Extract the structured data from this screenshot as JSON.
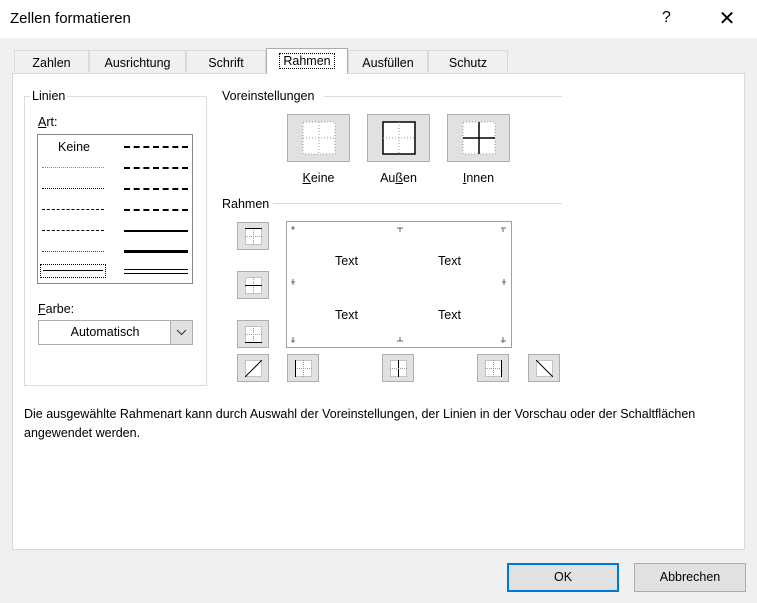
{
  "window": {
    "title": "Zellen formatieren",
    "help": "?",
    "close": "✕"
  },
  "tabs": [
    {
      "label": "Zahlen"
    },
    {
      "label": "Ausrichtung"
    },
    {
      "label": "Schrift"
    },
    {
      "label": "Rahmen"
    },
    {
      "label": "Ausfüllen"
    },
    {
      "label": "Schutz"
    }
  ],
  "lines_group": {
    "title": "Linien",
    "style_label_pre": "",
    "style_label_u": "A",
    "style_label_post": "rt:",
    "none_label": "Keine",
    "color_label_u": "F",
    "color_label_post": "arbe:",
    "color_value": "Automatisch"
  },
  "presets": {
    "title": "Voreinstellungen",
    "items": [
      {
        "pre": "",
        "u": "K",
        "post": "eine"
      },
      {
        "pre": "Au",
        "u": "ß",
        "post": "en"
      },
      {
        "pre": "",
        "u": "I",
        "post": "nnen"
      }
    ]
  },
  "border": {
    "title": "Rahmen",
    "preview_texts": [
      "Text",
      "Text",
      "Text",
      "Text"
    ]
  },
  "description": "Die ausgewählte Rahmenart kann durch Auswahl der Voreinstellungen, der Linien in der Vorschau oder der Schaltflächen angewendet werden.",
  "buttons": {
    "ok": "OK",
    "cancel": "Abbrechen"
  },
  "colors": {
    "accent": "#0078d7",
    "button_face": "#e1e1e1",
    "panel": "#ffffff",
    "background": "#f0f0f0"
  }
}
